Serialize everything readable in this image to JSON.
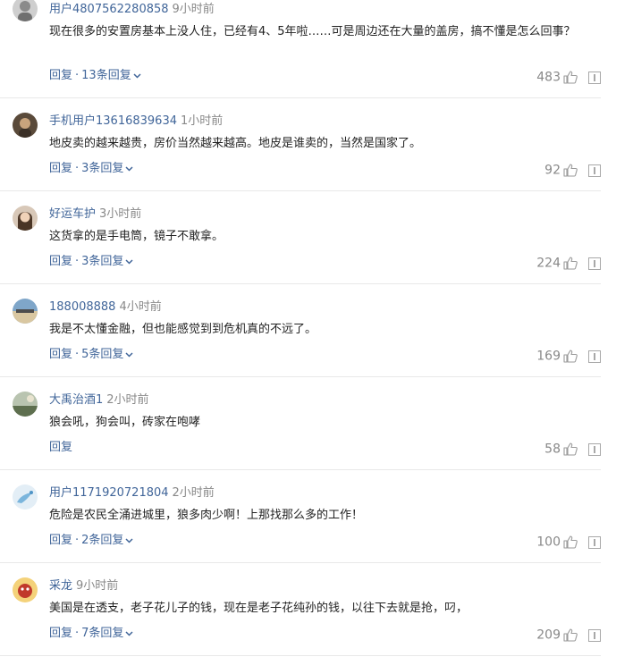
{
  "labels": {
    "reply": "回复",
    "separator": "·"
  },
  "comments": [
    {
      "username": "用户4807562280858",
      "time": "9小时前",
      "content": "现在很多的安置房基本上没人住，已经有4、5年啦……可是周边还在大量的盖房，搞不懂是怎么回事？",
      "replies": "13条回复",
      "likes": "483",
      "avatar_icon": "avatar-gray-figure-icon"
    },
    {
      "username": "手机用户13616839634",
      "time": "1小时前",
      "content": "地皮卖的越来越贵，房价当然越来越高。地皮是谁卖的，当然是国家了。",
      "replies": "3条回复",
      "likes": "92",
      "avatar_icon": "avatar-portrait-icon"
    },
    {
      "username": "好运车护",
      "time": "3小时前",
      "content": "这货拿的是手电筒，镜子不敢拿。",
      "replies": "3条回复",
      "likes": "224",
      "avatar_icon": "avatar-woman-icon"
    },
    {
      "username": "188008888",
      "time": "4小时前",
      "content": "我是不太懂金融，但也能感觉到到危机真的不远了。",
      "replies": "5条回复",
      "likes": "169",
      "avatar_icon": "avatar-landscape-icon"
    },
    {
      "username": "大禹治酒1",
      "time": "2小时前",
      "content": "狼会吼，狗会叫，砖家在咆哮",
      "replies": "",
      "likes": "58",
      "avatar_icon": "avatar-scenery-icon"
    },
    {
      "username": "用户1171920721804",
      "time": "2小时前",
      "content": "危险是农民全涌进城里，狼多肉少啊！上那找那么多的工作！",
      "replies": "2条回复",
      "likes": "100",
      "avatar_icon": "avatar-default-blue-icon"
    },
    {
      "username": "采龙",
      "time": "9小时前",
      "content": "美国是在透支，老子花儿子的钱，现在是老子花纯孙的钱，以往下去就是抢，叼，",
      "replies": "7条回复",
      "likes": "209",
      "avatar_icon": "avatar-cartoon-icon"
    }
  ],
  "colors": {
    "link": "#406599",
    "muted": "#888888",
    "text": "#222222",
    "divider": "#e8e8e8"
  }
}
